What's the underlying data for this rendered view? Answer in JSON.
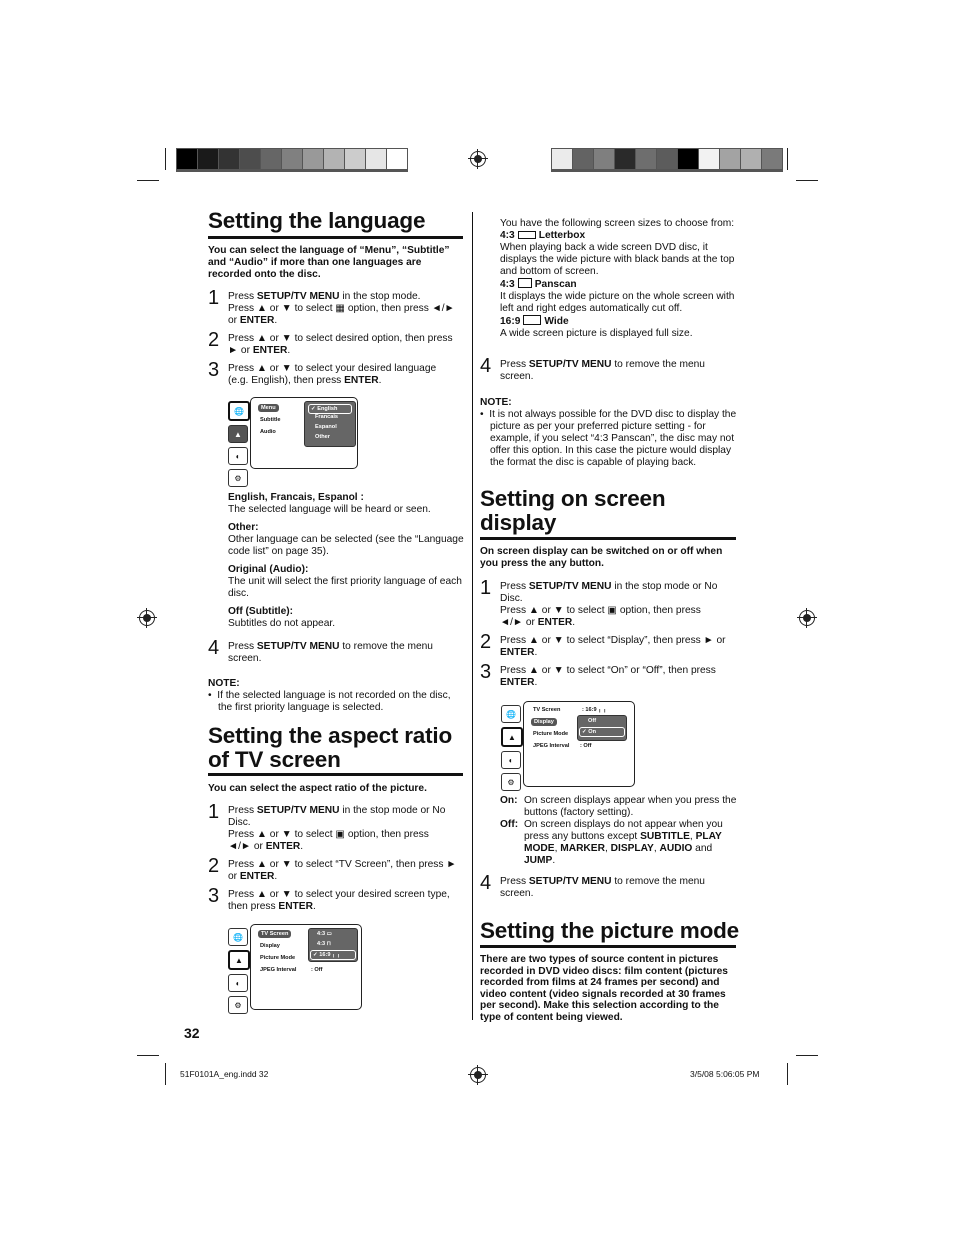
{
  "colorbars": {
    "left": [
      "#000000",
      "#1a1a1a",
      "#333333",
      "#4d4d4d",
      "#666666",
      "#808080",
      "#999999",
      "#b3b3b3",
      "#cccccc",
      "#e6e6e6",
      "#ffffff"
    ],
    "right": [
      "#ebebeb",
      "#636363",
      "#7f7f7f",
      "#2a2a2a",
      "#6e6e6e",
      "#5c5c5c",
      "#000000",
      "#f2f2f2",
      "#a3a3a3",
      "#b0b0b0",
      "#7a7a7a"
    ]
  },
  "language": {
    "title": "Setting the language",
    "lead": "You can select the language of “Menu”, “Subtitle” and “Audio” if more than one languages are recorded onto the disc.",
    "steps": [
      {
        "num": "1",
        "html": "Press <b>SETUP/TV MENU</b> in the stop mode.<br>Press ▲ or ▼ to select <span class=\"mini-icon\">▦</span> option, then press ◄/►<br>or <b>ENTER</b>."
      },
      {
        "num": "2",
        "html": "Press ▲ or ▼ to select desired option, then press<br>► or <b>ENTER</b>."
      },
      {
        "num": "3",
        "html": "Press ▲ or ▼ to select your desired language<br>(e.g. English), then press <b>ENTER</b>."
      }
    ],
    "osd": {
      "items": [
        "Menu",
        "Subtitle",
        "Audio"
      ],
      "options": [
        "English",
        "Francais",
        "Espanol",
        "Other"
      ],
      "selected": "English"
    },
    "definitions": [
      {
        "term": "English, Francais, Espanol :",
        "desc": "The selected language will be heard or seen."
      },
      {
        "term": "Other:",
        "desc": "Other language can be selected (see the “Language code list” on page 35)."
      },
      {
        "term": "Original (Audio):",
        "desc": "The unit will select the first priority language of each disc."
      },
      {
        "term": "Off (Subtitle):",
        "desc": "Subtitles do not appear."
      }
    ],
    "step4": {
      "num": "4",
      "html": "Press <b>SETUP/TV MENU</b> to remove the menu<br>screen."
    },
    "note_title": "NOTE:",
    "note": "If the selected language is not recorded on the disc, the first priority language is selected."
  },
  "aspect": {
    "title_line1": "Setting the aspect ratio",
    "title_line2": "of TV screen",
    "lead": "You can select the aspect ratio of the picture.",
    "steps": [
      {
        "num": "1",
        "html": "Press <b>SETUP/TV MENU</b> in the stop mode or No<br>Disc.<br>Press ▲ or ▼ to select <span class=\"mini-icon\">▣</span> option, then press<br>◄/► or <b>ENTER</b>."
      },
      {
        "num": "2",
        "html": "Press ▲ or ▼ to select “TV Screen”, then press ►<br>or <b>ENTER</b>."
      },
      {
        "num": "3",
        "html": "Press ▲ or ▼ to select your desired screen type,<br>then press <b>ENTER</b>."
      }
    ],
    "osd": {
      "items": [
        "TV Screen",
        "Display",
        "Picture Mode",
        "JPEG Interval"
      ],
      "jpeg_value": ": Off",
      "options": [
        "4:3",
        "4:3",
        "16:9"
      ],
      "selected": "16:9"
    },
    "intro": "You have the following screen sizes to choose from:",
    "types": [
      {
        "ratio": "4:3",
        "name": "Letterbox",
        "desc": "When playing back a wide screen DVD disc, it displays the wide picture with black bands at the top and bottom of screen."
      },
      {
        "ratio": "4:3",
        "name": "Panscan",
        "desc": "It displays the wide picture on the whole screen with left and right edges automatically cut off."
      },
      {
        "ratio": "16:9",
        "name": "Wide",
        "desc": "A wide screen picture is displayed full size."
      }
    ],
    "step4": {
      "num": "4",
      "html": "Press <b>SETUP/TV MENU</b> to remove the menu<br>screen."
    },
    "note_title": "NOTE:",
    "note": "It is not always possible for the DVD disc to display the picture as per your preferred picture setting - for example, if you select “4:3 Panscan”, the disc may not offer this option. In this case the picture would display the format the disc is capable of playing back."
  },
  "osd_section": {
    "title_line1": "Setting on screen",
    "title_line2": "display",
    "lead": "On screen display can be switched on or off when you press the any button.",
    "steps": [
      {
        "num": "1",
        "html": "Press <b>SETUP/TV MENU</b> in the stop mode or No<br>Disc.<br>Press ▲ or ▼ to select <span class=\"mini-icon\">▣</span> option, then press<br>◄/► or <b>ENTER</b>."
      },
      {
        "num": "2",
        "html": "Press ▲ or ▼ to select “Display”, then press ► or<br><b>ENTER</b>."
      },
      {
        "num": "3",
        "html": "Press ▲ or ▼ to select “On” or “Off”, then press<br><b>ENTER</b>."
      }
    ],
    "osd": {
      "items": [
        "TV Screen",
        "Display",
        "Picture Mode",
        "JPEG Interval"
      ],
      "tv_value": ": 16:9",
      "jpeg_value": ": Off",
      "options": [
        "Off",
        "On"
      ],
      "selected": "On"
    },
    "on_label": "On:",
    "on_desc": "On screen displays appear when you press the buttons (factory setting).",
    "off_label": "Off:",
    "off_desc_html": "On screen displays do not appear when you press any buttons except <b>SUBTITLE</b>, <b>PLAY MODE</b>, <b>MARKER</b>, <b>DISPLAY</b>, <b>AUDIO</b> and <b>JUMP</b>.",
    "step4": {
      "num": "4",
      "html": "Press <b>SETUP/TV MENU</b> to remove the menu<br>screen."
    }
  },
  "picture_mode": {
    "title": "Setting the picture mode",
    "lead": "There are two types of source content in pictures recorded in DVD video discs: film content (pictures recorded from films at 24 frames per second) and video content (video signals recorded at 30 frames per second). Make this selection according to the type of content being viewed."
  },
  "page_number": "32",
  "footer": {
    "file": "51F0101A_eng.indd   32",
    "date": "3/5/08   5:06:05 PM"
  }
}
